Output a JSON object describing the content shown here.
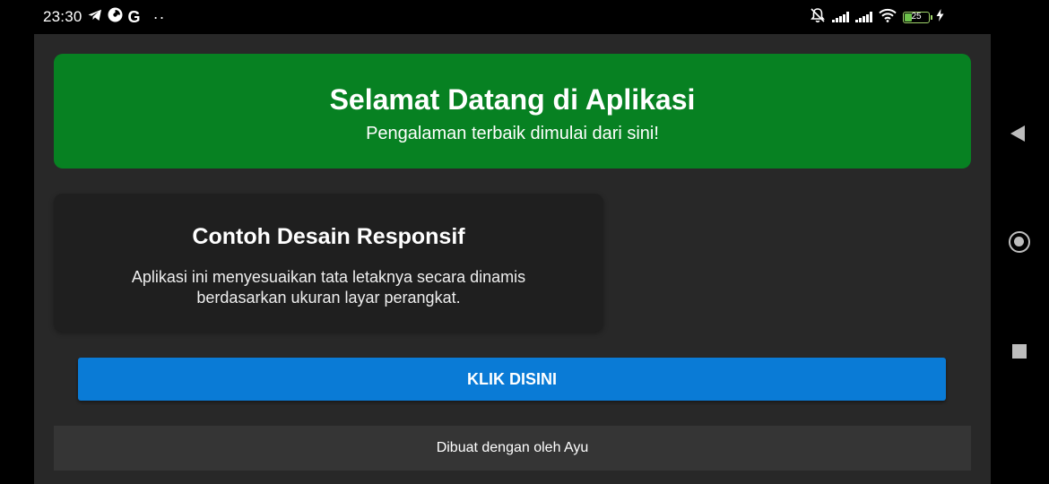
{
  "status_bar": {
    "time": "23:30",
    "left_icons": [
      "telegram-icon",
      "pie-chart-icon",
      "google-icon",
      "more-dots-icon"
    ],
    "google_glyph": "G",
    "dots_glyph": "··",
    "right_icons": [
      "bell-off-icon",
      "signal-icon",
      "signal-icon",
      "wifi-icon",
      "battery-icon",
      "charging-icon"
    ],
    "battery_level": "25"
  },
  "header": {
    "title": "Selamat Datang di Aplikasi",
    "subtitle": "Pengalaman terbaik dimulai dari sini!",
    "color": "#078122"
  },
  "card": {
    "title": "Contoh Desain Responsif",
    "body": "Aplikasi ini menyesuaikan tata letaknya secara dinamis berdasarkan ukuran layar perangkat."
  },
  "cta": {
    "label": "KLIK DISINI",
    "color": "#0a7bd6"
  },
  "footer": {
    "text": "Dibuat dengan oleh Ayu"
  },
  "nav_bar": {
    "icons": [
      "back-icon",
      "home-icon",
      "recents-icon"
    ]
  }
}
